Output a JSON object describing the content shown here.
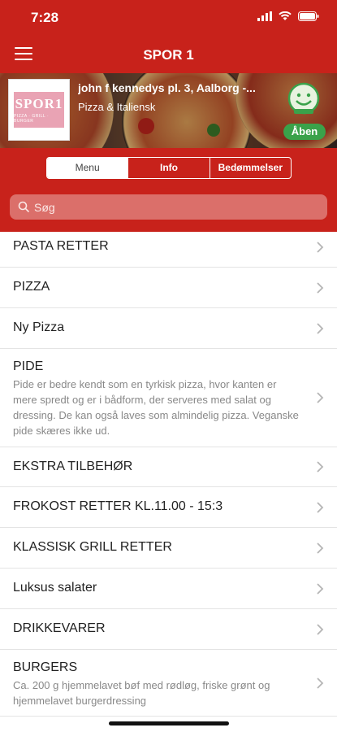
{
  "status": {
    "time": "7:28"
  },
  "nav": {
    "title": "SPOR 1"
  },
  "restaurant": {
    "address": "john f kennedys pl. 3, Aalborg -...",
    "category": "Pizza & Italiensk",
    "logo_text": "SPOR1",
    "logo_sub": "PIZZA · GRILL · BURGER",
    "status_badge": "Åben"
  },
  "tabs": [
    {
      "label": "Menu"
    },
    {
      "label": "Info"
    },
    {
      "label": "Bedømmelser"
    }
  ],
  "search": {
    "placeholder": "Søg"
  },
  "menu_items": [
    {
      "title": "PASTA RETTER"
    },
    {
      "title": "PIZZA"
    },
    {
      "title": "Ny Pizza"
    },
    {
      "title": "PIDE",
      "description": "Pide er bedre kendt som en tyrkisk pizza, hvor kanten er mere spredt og er i bådform, der serveres med salat og dressing. De kan også laves som almindelig pizza. Veganske pide skæres ikke ud."
    },
    {
      "title": "EKSTRA TILBEHØR"
    },
    {
      "title": "FROKOST RETTER KL.11.00 - 15:3"
    },
    {
      "title": "KLASSISK GRILL RETTER"
    },
    {
      "title": "Luksus salater"
    },
    {
      "title": "DRIKKEVARER"
    },
    {
      "title": "BURGERS",
      "description": "Ca. 200 g hjemmelavet bøf med rødløg, friske grønt og hjemmelavet burgerdressing"
    }
  ],
  "colors": {
    "brand_red": "#c8221b",
    "open_green": "#3aa24a"
  }
}
